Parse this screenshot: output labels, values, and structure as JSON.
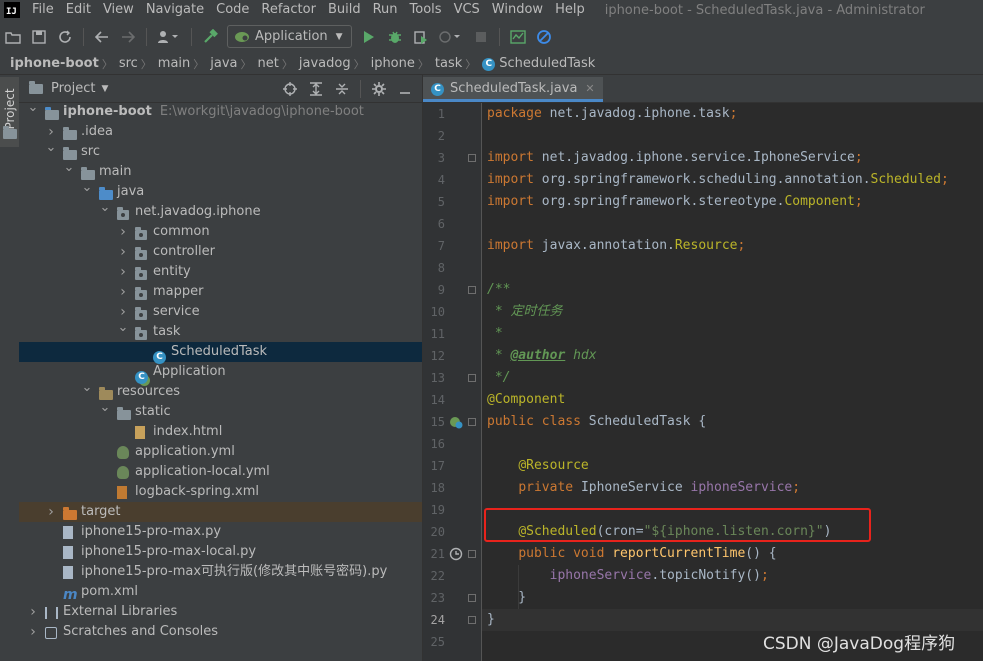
{
  "menubar": {
    "items": [
      "File",
      "Edit",
      "View",
      "Navigate",
      "Code",
      "Refactor",
      "Build",
      "Run",
      "Tools",
      "VCS",
      "Window",
      "Help"
    ],
    "window_title": "iphone-boot - ScheduledTask.java - Administrator"
  },
  "toolbar": {
    "run_config": "Application"
  },
  "breadcrumbs": [
    "iphone-boot",
    "src",
    "main",
    "java",
    "net",
    "javadog",
    "iphone",
    "task",
    "ScheduledTask"
  ],
  "left_tab": {
    "label": "Project"
  },
  "project_panel": {
    "title": "Project",
    "tree": [
      {
        "label": "iphone-boot",
        "path": "E:\\workgit\\javadog\\iphone-boot",
        "depth": 0,
        "arrow": "down",
        "icon": "module-folder-icon",
        "bold": true
      },
      {
        "label": ".idea",
        "depth": 1,
        "arrow": "right",
        "icon": "folder-icon"
      },
      {
        "label": "src",
        "depth": 1,
        "arrow": "down",
        "icon": "folder-icon"
      },
      {
        "label": "main",
        "depth": 2,
        "arrow": "down",
        "icon": "folder-icon"
      },
      {
        "label": "java",
        "depth": 3,
        "arrow": "down",
        "icon": "source-folder-icon"
      },
      {
        "label": "net.javadog.iphone",
        "depth": 4,
        "arrow": "down",
        "icon": "package-icon"
      },
      {
        "label": "common",
        "depth": 5,
        "arrow": "right",
        "icon": "package-icon"
      },
      {
        "label": "controller",
        "depth": 5,
        "arrow": "right",
        "icon": "package-icon"
      },
      {
        "label": "entity",
        "depth": 5,
        "arrow": "right",
        "icon": "package-icon"
      },
      {
        "label": "mapper",
        "depth": 5,
        "arrow": "right",
        "icon": "package-icon"
      },
      {
        "label": "service",
        "depth": 5,
        "arrow": "right",
        "icon": "package-icon"
      },
      {
        "label": "task",
        "depth": 5,
        "arrow": "down",
        "icon": "package-icon"
      },
      {
        "label": "ScheduledTask",
        "depth": 6,
        "arrow": "none",
        "icon": "class-icon",
        "selected": true
      },
      {
        "label": "Application",
        "depth": 5,
        "arrow": "none",
        "icon": "spring-class-icon"
      },
      {
        "label": "resources",
        "depth": 3,
        "arrow": "down",
        "icon": "resources-folder-icon"
      },
      {
        "label": "static",
        "depth": 4,
        "arrow": "down",
        "icon": "folder-icon"
      },
      {
        "label": "index.html",
        "depth": 5,
        "arrow": "none",
        "icon": "html-file-icon"
      },
      {
        "label": "application.yml",
        "depth": 4,
        "arrow": "none",
        "icon": "yml-file-icon"
      },
      {
        "label": "application-local.yml",
        "depth": 4,
        "arrow": "none",
        "icon": "yml-file-icon"
      },
      {
        "label": "logback-spring.xml",
        "depth": 4,
        "arrow": "none",
        "icon": "xml-file-icon"
      },
      {
        "label": "target",
        "depth": 1,
        "arrow": "right",
        "icon": "target-folder-icon",
        "excluded": true
      },
      {
        "label": "iphone15-pro-max.py",
        "depth": 1,
        "arrow": "none",
        "icon": "py-file-icon"
      },
      {
        "label": "iphone15-pro-max-local.py",
        "depth": 1,
        "arrow": "none",
        "icon": "py-file-icon"
      },
      {
        "label": "iphone15-pro-max可执行版(修改其中账号密码).py",
        "depth": 1,
        "arrow": "none",
        "icon": "py-file-icon"
      },
      {
        "label": "pom.xml",
        "depth": 1,
        "arrow": "none",
        "icon": "maven-file-icon"
      },
      {
        "label": "External Libraries",
        "depth": 0,
        "arrow": "right",
        "icon": "libraries-icon"
      },
      {
        "label": "Scratches and Consoles",
        "depth": 0,
        "arrow": "right",
        "icon": "scratches-icon"
      }
    ]
  },
  "editor": {
    "tab_label": "ScheduledTask.java",
    "current_line": 24,
    "lines": [
      {
        "n": "1",
        "segs": [
          [
            "kw",
            "package "
          ],
          [
            "plain",
            "net.javadog.iphone.task"
          ],
          [
            "kw",
            ";"
          ]
        ]
      },
      {
        "n": "2",
        "segs": []
      },
      {
        "n": "3",
        "segs": [
          [
            "kw",
            "import "
          ],
          [
            "plain",
            "net.javadog.iphone.service.IphoneService"
          ],
          [
            "kw",
            ";"
          ]
        ]
      },
      {
        "n": "4",
        "segs": [
          [
            "kw",
            "import "
          ],
          [
            "plain",
            "org.springframework.scheduling.annotation."
          ],
          [
            "ann",
            "Scheduled"
          ],
          [
            "kw",
            ";"
          ]
        ]
      },
      {
        "n": "5",
        "segs": [
          [
            "kw",
            "import "
          ],
          [
            "plain",
            "org.springframework.stereotype."
          ],
          [
            "ann",
            "Component"
          ],
          [
            "kw",
            ";"
          ]
        ]
      },
      {
        "n": "6",
        "segs": []
      },
      {
        "n": "7",
        "segs": [
          [
            "kw",
            "import "
          ],
          [
            "plain",
            "javax.annotation."
          ],
          [
            "ann",
            "Resource"
          ],
          [
            "kw",
            ";"
          ]
        ]
      },
      {
        "n": "8",
        "segs": []
      },
      {
        "n": "9",
        "segs": [
          [
            "cmt",
            "/**"
          ]
        ]
      },
      {
        "n": "10",
        "segs": [
          [
            "cmt",
            " * 定时任务"
          ]
        ]
      },
      {
        "n": "11",
        "segs": [
          [
            "cmt",
            " *"
          ]
        ]
      },
      {
        "n": "12",
        "segs": [
          [
            "cmt",
            " * "
          ],
          [
            "cmttag",
            "@author"
          ],
          [
            "cmt",
            " hdx"
          ]
        ]
      },
      {
        "n": "13",
        "segs": [
          [
            "cmt",
            " */"
          ]
        ]
      },
      {
        "n": "14",
        "segs": [
          [
            "ann",
            "@Component"
          ]
        ]
      },
      {
        "n": "15",
        "segs": [
          [
            "kw",
            "public class "
          ],
          [
            "plain",
            "ScheduledTask "
          ],
          [
            "plain",
            "{"
          ]
        ]
      },
      {
        "n": "16",
        "segs": []
      },
      {
        "n": "17",
        "segs": [
          [
            "plain",
            "    "
          ],
          [
            "ann",
            "@Resource"
          ]
        ]
      },
      {
        "n": "18",
        "segs": [
          [
            "plain",
            "    "
          ],
          [
            "kw",
            "private "
          ],
          [
            "plain",
            "IphoneService "
          ],
          [
            "fld",
            "iphoneService"
          ],
          [
            "kw",
            ";"
          ]
        ]
      },
      {
        "n": "19",
        "segs": []
      },
      {
        "n": "20",
        "segs": [
          [
            "plain",
            "    "
          ],
          [
            "ann",
            "@Scheduled"
          ],
          [
            "plain",
            "(cron="
          ],
          [
            "str",
            "\"${iphone.listen.corn}\""
          ],
          [
            "plain",
            ")"
          ]
        ]
      },
      {
        "n": "21",
        "segs": [
          [
            "plain",
            "    "
          ],
          [
            "kw",
            "public void "
          ],
          [
            "mth",
            "reportCurrentTime"
          ],
          [
            "plain",
            "() {"
          ]
        ]
      },
      {
        "n": "22",
        "segs": [
          [
            "plain",
            "        "
          ],
          [
            "fld",
            "iphoneService"
          ],
          [
            "plain",
            "."
          ],
          [
            "plain",
            "topicNotify"
          ],
          [
            "plain",
            "()"
          ],
          [
            "kw",
            ";"
          ]
        ]
      },
      {
        "n": "23",
        "segs": [
          [
            "plain",
            "    }"
          ]
        ]
      },
      {
        "n": "24",
        "segs": [
          [
            "plain",
            "}"
          ]
        ]
      },
      {
        "n": "25",
        "segs": []
      }
    ]
  },
  "watermark": "CSDN @JavaDog程序狗",
  "colors": {
    "selection": "#0d293e",
    "highlight_box": "#e8231c",
    "keyword": "#cc7832",
    "annotation": "#bbb529",
    "field": "#9876aa",
    "string": "#6a8759",
    "comment": "#629755"
  }
}
